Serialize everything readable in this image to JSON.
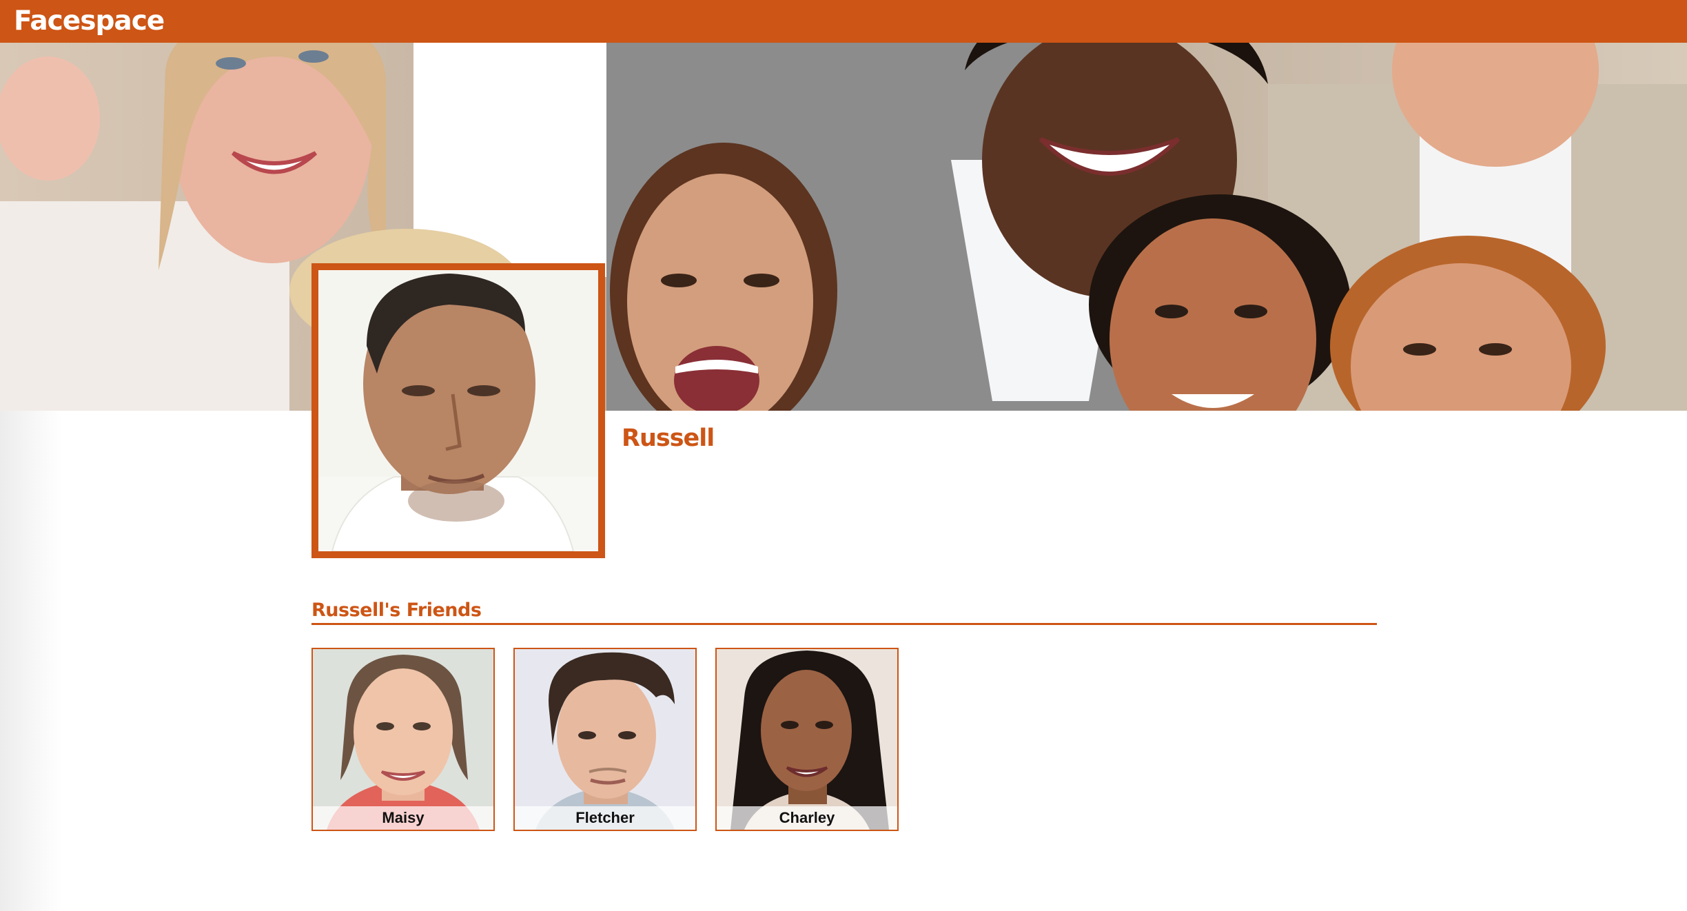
{
  "header": {
    "brand": "Facespace"
  },
  "cover": {
    "image": "group-of-smiling-people-photo"
  },
  "profile": {
    "name": "Russell",
    "photo": "russell-portrait-photo"
  },
  "friends": {
    "heading": "Russell's Friends",
    "items": [
      {
        "name": "Maisy",
        "photo": "maisy-portrait-photo"
      },
      {
        "name": "Fletcher",
        "photo": "fletcher-portrait-photo"
      },
      {
        "name": "Charley",
        "photo": "charley-portrait-photo"
      }
    ]
  },
  "colors": {
    "accent": "#cd5515",
    "background": "#ffffff",
    "label_text": "#111111"
  }
}
